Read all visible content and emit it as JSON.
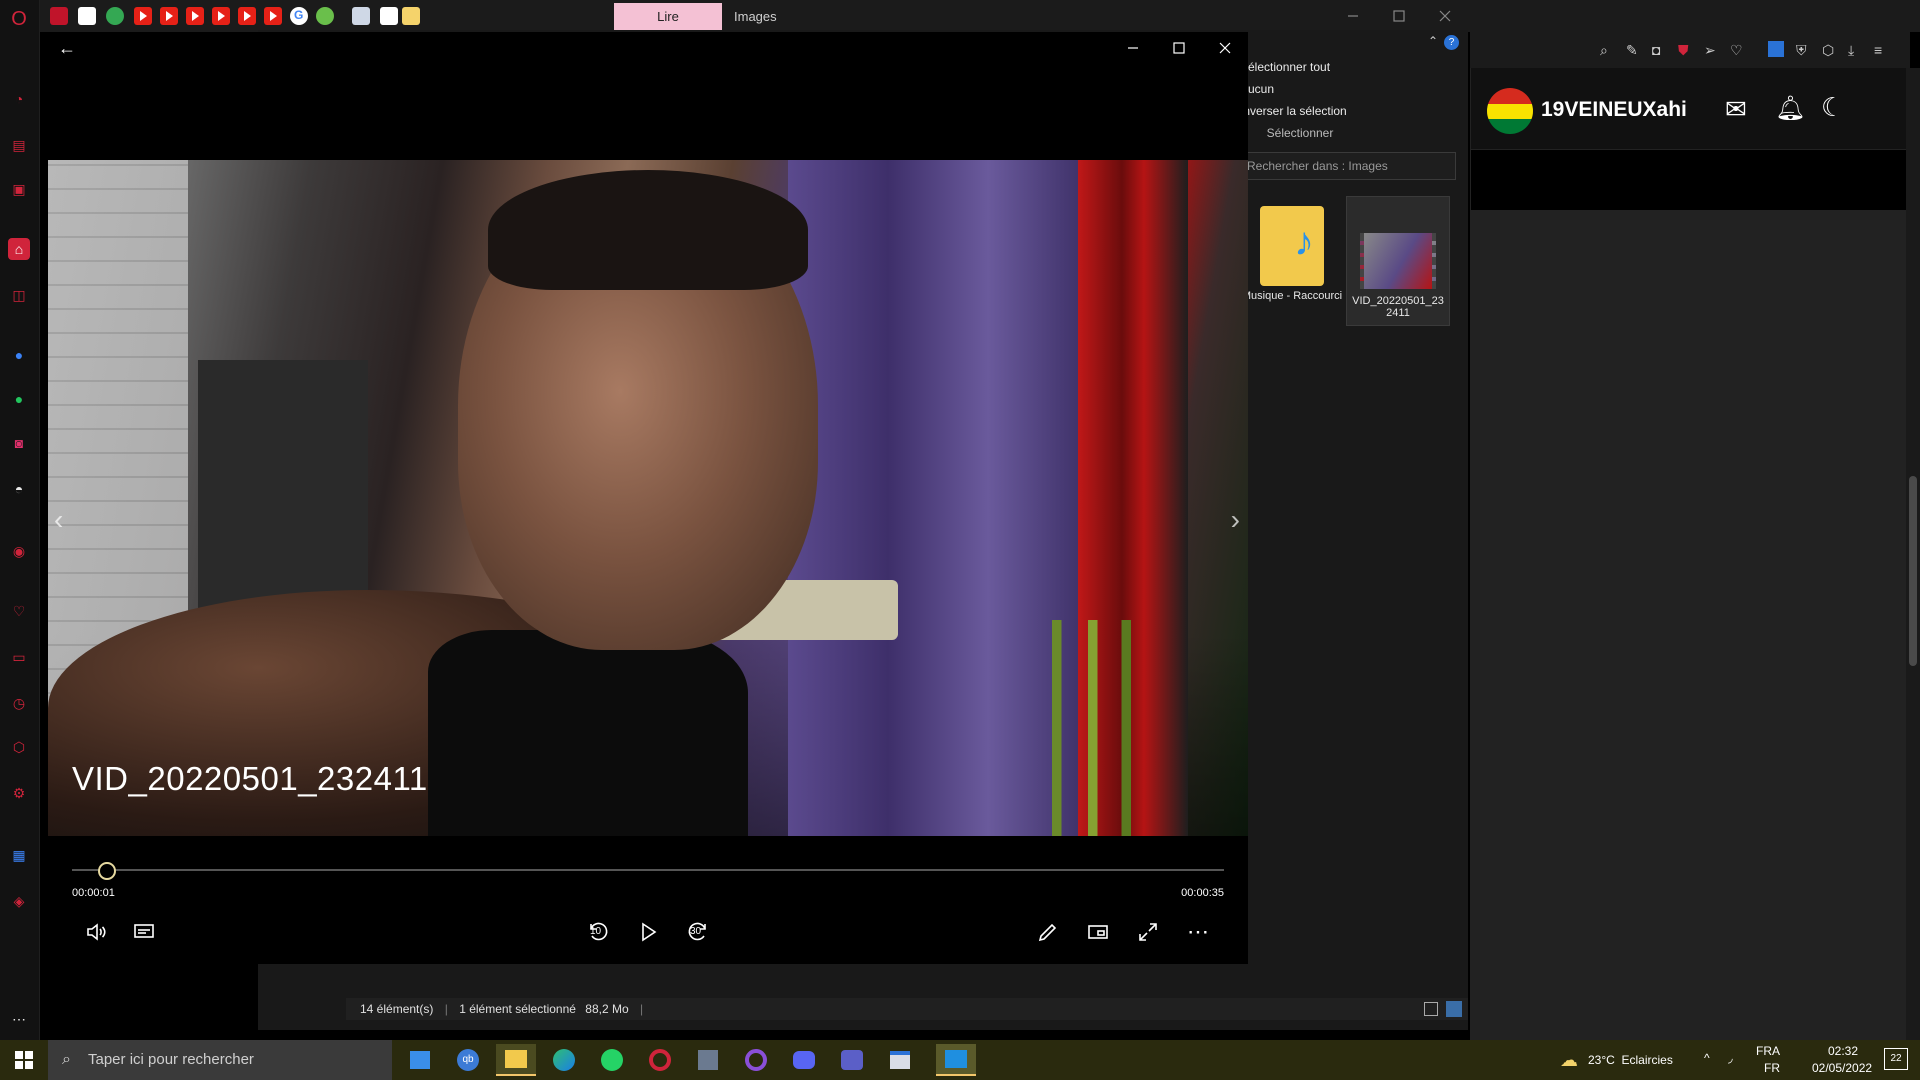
{
  "browser": {
    "tab_lire": "Lire",
    "explorer_title": "Images"
  },
  "explorer": {
    "menu": [
      "Sélectionner tout",
      "Aucun",
      "Inverser la sélection",
      "Sélectionner"
    ],
    "search_placeholder": "Rechercher dans : Images",
    "files": [
      {
        "name": "Musique - Raccourci",
        "icon": "music-folder-icon"
      },
      {
        "name": "VID_20220501_232411",
        "icon": "video-thumbnail"
      }
    ],
    "status": {
      "count": "14 élément(s)",
      "selected": "1 élément sélectionné",
      "size": "88,2 Mo"
    }
  },
  "web": {
    "username": "19VEINEUXahi",
    "flag_colors": [
      "#d52b1e",
      "#f9e300",
      "#007934"
    ]
  },
  "player": {
    "video_title": "VID_20220501_232411",
    "time_current": "00:00:01",
    "time_total": "00:00:35",
    "progress": 0.03,
    "skip_back_label": "10",
    "skip_forward_label": "30"
  },
  "taskbar": {
    "search_placeholder": "Taper ici pour rechercher",
    "weather": "23°C  Eclaircies",
    "lang_top": "FRA",
    "lang_bottom": "FR",
    "time": "02:32",
    "date": "02/05/2022",
    "notifications": "22"
  }
}
